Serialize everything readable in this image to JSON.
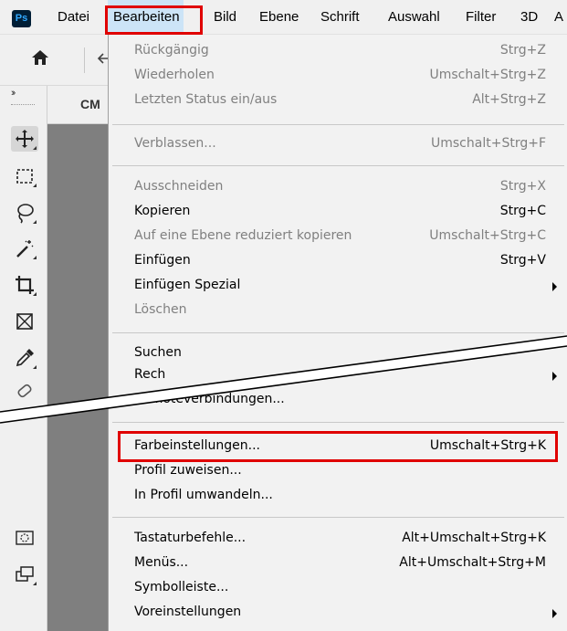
{
  "app": {
    "logo_text": "Ps"
  },
  "menubar": {
    "items": [
      {
        "label": "Datei"
      },
      {
        "label": "Bearbeiten",
        "active": true
      },
      {
        "label": "Bild"
      },
      {
        "label": "Ebene"
      },
      {
        "label": "Schrift"
      },
      {
        "label": "Auswahl"
      },
      {
        "label": "Filter"
      },
      {
        "label": "3D"
      },
      {
        "label": "A"
      }
    ]
  },
  "document": {
    "tab_label": "CM"
  },
  "toolbar": {
    "tools": [
      {
        "icon": "move-icon",
        "selected": true
      },
      {
        "icon": "marquee-icon"
      },
      {
        "icon": "lasso-icon"
      },
      {
        "icon": "magic-wand-icon"
      },
      {
        "icon": "crop-icon"
      },
      {
        "icon": "frame-icon"
      },
      {
        "icon": "eyedropper-icon"
      },
      {
        "icon": "healing-brush-icon"
      },
      {
        "icon": "quick-mask-icon"
      },
      {
        "icon": "screen-mode-icon"
      }
    ]
  },
  "edit_menu": {
    "items": [
      {
        "label": "Rückgängig",
        "shortcut": "Strg+Z",
        "disabled": true
      },
      {
        "label": "Wiederholen",
        "shortcut": "Umschalt+Strg+Z",
        "disabled": true
      },
      {
        "label": "Letzten Status ein/aus",
        "shortcut": "Alt+Strg+Z",
        "disabled": true
      },
      {
        "label": "Verblassen...",
        "shortcut": "Umschalt+Strg+F",
        "disabled": true
      },
      {
        "label": "Ausschneiden",
        "shortcut": "Strg+X",
        "disabled": true
      },
      {
        "label": "Kopieren",
        "shortcut": "Strg+C",
        "disabled": false
      },
      {
        "label": "Auf eine Ebene reduziert kopieren",
        "shortcut": "Umschalt+Strg+C",
        "disabled": true
      },
      {
        "label": "Einfügen",
        "shortcut": "Strg+V",
        "disabled": false
      },
      {
        "label": "Einfügen Spezial",
        "shortcut": "",
        "disabled": false,
        "submenu": true
      },
      {
        "label": "Löschen",
        "shortcut": "",
        "disabled": true
      },
      {
        "label": "Suchen",
        "shortcut": "",
        "disabled": false
      },
      {
        "label": "Rech",
        "shortcut": "",
        "disabled": false,
        "submenu": true
      },
      {
        "label": "Remoteverbindungen...",
        "shortcut": "",
        "disabled": false
      },
      {
        "label": "Farbeinstellungen...",
        "shortcut": "Umschalt+Strg+K",
        "disabled": false,
        "highlighted": true
      },
      {
        "label": "Profil zuweisen...",
        "shortcut": "",
        "disabled": false
      },
      {
        "label": "In Profil umwandeln...",
        "shortcut": "",
        "disabled": false
      },
      {
        "label": "Tastaturbefehle...",
        "shortcut": "Alt+Umschalt+Strg+K",
        "disabled": false
      },
      {
        "label": "Menüs...",
        "shortcut": "Alt+Umschalt+Strg+M",
        "disabled": false
      },
      {
        "label": "Symbolleiste...",
        "shortcut": "",
        "disabled": false
      },
      {
        "label": "Voreinstellungen",
        "shortcut": "",
        "disabled": false,
        "submenu": true
      }
    ]
  },
  "colors": {
    "highlight_border": "#e00000",
    "menu_active": "#cce4f7",
    "disabled_text": "#808080",
    "canvas": "#7f7f7f",
    "ps_logo_bg": "#001e36",
    "ps_logo_fg": "#31a8ff"
  }
}
